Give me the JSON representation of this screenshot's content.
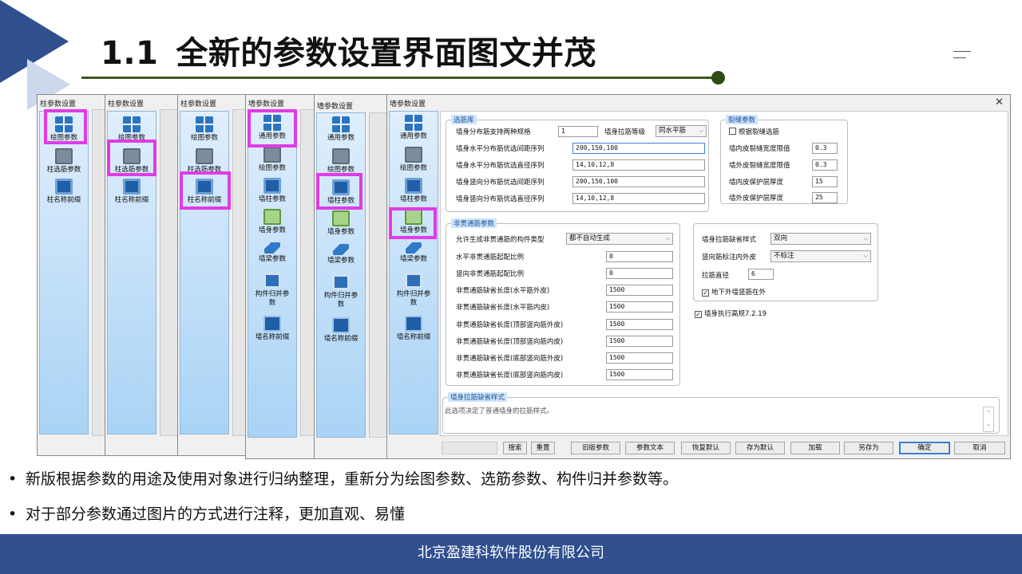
{
  "slide": {
    "number": "1.1",
    "title": "全新的参数设置界面图文并茂",
    "bullets": [
      "新版根据参数的用途及使用对象进行归纳整理，重新分为绘图参数、选筋参数、构件归并参数等。",
      "对于部分参数通过图片的方式进行注释，更加直观、易懂"
    ],
    "footer": "北京盈建科软件股份有限公司",
    "accent_color": "#2f4f8f",
    "highlight_color": "#e03be6"
  },
  "dialogs": [
    {
      "title": "柱参数设置",
      "items": [
        {
          "label": "绘图参数",
          "icon": "grid-icon"
        },
        {
          "label": "柱选筋参数",
          "icon": "bar-icon"
        },
        {
          "label": "柱名称前缀",
          "icon": "doc-icon"
        }
      ]
    },
    {
      "title": "柱参数设置",
      "items": [
        {
          "label": "绘图参数",
          "icon": "grid-icon"
        },
        {
          "label": "柱选筋参数",
          "icon": "bar-icon"
        },
        {
          "label": "柱名称前缀",
          "icon": "doc-icon"
        }
      ]
    },
    {
      "title": "柱参数设置",
      "items": [
        {
          "label": "绘图参数",
          "icon": "grid-icon"
        },
        {
          "label": "柱选筋参数",
          "icon": "bar-icon"
        },
        {
          "label": "柱名称前缀",
          "icon": "doc-icon"
        }
      ]
    },
    {
      "title": "墙参数设置",
      "items": [
        {
          "label": "通用参数",
          "icon": "grid-icon"
        },
        {
          "label": "绘图参数",
          "icon": "bar-icon"
        },
        {
          "label": "墙柱参数",
          "icon": "doc-icon"
        },
        {
          "label": "墙身参数",
          "icon": "green-icon"
        },
        {
          "label": "墙梁参数",
          "icon": "beam-icon"
        },
        {
          "label": "构件归并参数",
          "icon": "list-icon"
        },
        {
          "label": "墙名称前缀",
          "icon": "name-icon"
        }
      ]
    },
    {
      "title": "墙参数设置",
      "items": [
        {
          "label": "通用参数",
          "icon": "grid-icon"
        },
        {
          "label": "绘图参数",
          "icon": "bar-icon"
        },
        {
          "label": "墙柱参数",
          "icon": "doc-icon"
        },
        {
          "label": "墙身参数",
          "icon": "green-icon"
        },
        {
          "label": "墙梁参数",
          "icon": "beam-icon"
        },
        {
          "label": "构件归并参数",
          "icon": "list-icon"
        },
        {
          "label": "墙名称前缀",
          "icon": "name-icon"
        }
      ]
    }
  ],
  "main_dialog": {
    "title": "墙参数设置",
    "sidebar": [
      {
        "label": "通用参数",
        "icon": "grid-icon"
      },
      {
        "label": "绘图参数",
        "icon": "bar-icon"
      },
      {
        "label": "墙柱参数",
        "icon": "doc-icon"
      },
      {
        "label": "墙身参数",
        "icon": "green-icon"
      },
      {
        "label": "墙梁参数",
        "icon": "beam-icon"
      },
      {
        "label": "构件归并参数",
        "icon": "list-icon"
      },
      {
        "label": "墙名称前缀",
        "icon": "name-icon"
      }
    ],
    "xuanjin": {
      "title": "选筋库",
      "spec_label": "墙身分布筋支持两种规格",
      "spec_value": "1",
      "grade_label": "墙身拉筋等级",
      "grade_value": "同水平筋",
      "rows": [
        {
          "label": "墙身水平分布筋优选间距序列",
          "value": "200,150,100"
        },
        {
          "label": "墙身水平分布筋优选直径序列",
          "value": "14,10,12,8"
        },
        {
          "label": "墙身竖向分布筋优选间距序列",
          "value": "200,150,100"
        },
        {
          "label": "墙身竖向分布筋优选直径序列",
          "value": "14,10,12,8"
        }
      ]
    },
    "crack": {
      "title": "裂缝参数",
      "checkbox": "根据裂缝选筋",
      "rows": [
        {
          "label": "墙内皮裂缝宽度限值",
          "value": "0.3"
        },
        {
          "label": "墙外皮裂缝宽度限值",
          "value": "0.3"
        },
        {
          "label": "墙内皮保护层厚度",
          "value": "15"
        },
        {
          "label": "墙外皮保护层厚度",
          "value": "25"
        }
      ]
    },
    "nonthrough": {
      "title": "非贯通筋参数",
      "type_label": "允许生成非贯通筋的构件类型",
      "type_value": "都不自动生成",
      "rows": [
        {
          "label": "水平非贯通筋起配比例",
          "value": "0"
        },
        {
          "label": "竖向非贯通筋起配比例",
          "value": "0"
        },
        {
          "label": "非贯通筋缺省长度(水平筋外皮)",
          "value": "1500"
        },
        {
          "label": "非贯通筋缺省长度(水平筋内皮)",
          "value": "1500"
        },
        {
          "label": "非贯通筋缺省长度(顶部竖向筋外皮)",
          "value": "1500"
        },
        {
          "label": "非贯通筋缺省长度(顶部竖向筋内皮)",
          "value": "1500"
        },
        {
          "label": "非贯通筋缺省长度(底部竖向筋外皮)",
          "value": "1500"
        },
        {
          "label": "非贯通筋缺省长度(底部竖向筋内皮)",
          "value": "1500"
        }
      ]
    },
    "tie": {
      "style_label": "墙身拉筋缺省样式",
      "style_value": "双向",
      "mark_label": "竖向筋标注内外皮",
      "mark_value": "不标注",
      "dia_label": "拉筋直径",
      "dia_value": "6",
      "basement_check": "地下外墙竖筋在外",
      "code_check": "墙身执行高规7.2.19"
    },
    "desc": {
      "title": "墙身拉筋缺省样式",
      "text": "此选项决定了普通墙身的拉筋样式。"
    },
    "buttons": {
      "search": "搜索",
      "reset": "重置",
      "old": "旧版参数",
      "text": "参数文本",
      "restore": "恢复默认",
      "save_default": "存为默认",
      "load": "加载",
      "save_as": "另存为",
      "ok": "确定",
      "cancel": "取消"
    }
  }
}
